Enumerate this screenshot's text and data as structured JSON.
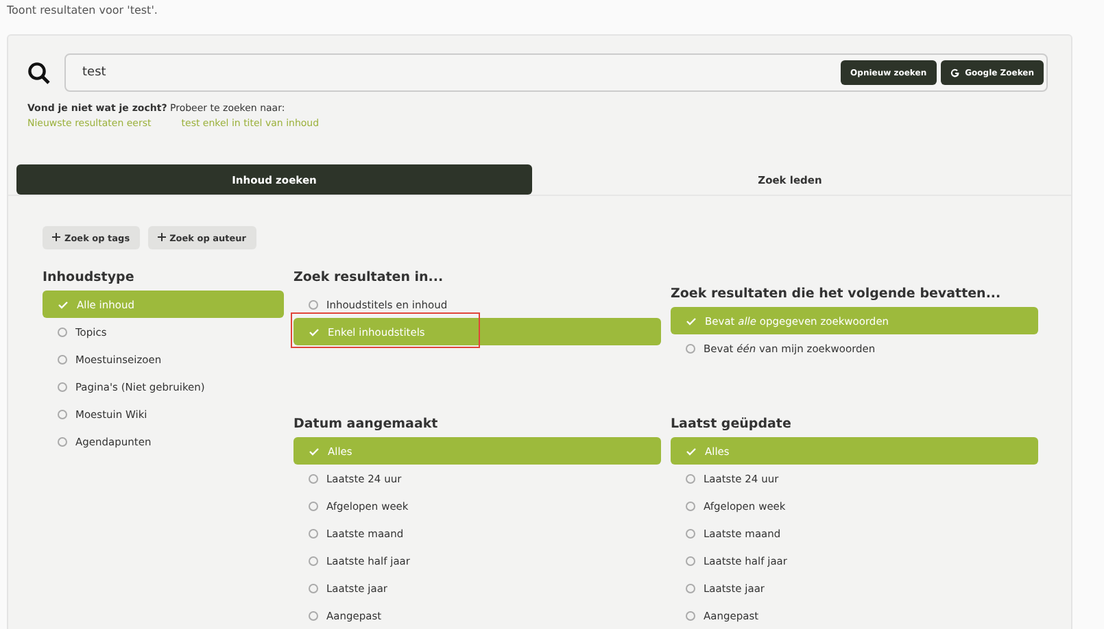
{
  "result_note": "Toont resultaten voor 'test'.",
  "search": {
    "value": "test",
    "buttons": [
      {
        "label": "Opnieuw zoeken",
        "kind": "plain"
      },
      {
        "label": "Google Zoeken",
        "kind": "google"
      }
    ]
  },
  "suggestions": {
    "prompt": "**Vond je niet wat je zocht?** Probeer te zoeken naar:",
    "links": [
      "Nieuwste resultaten eerst",
      "test enkel in titel van inhoud"
    ]
  },
  "tabs": [
    {
      "label": "Inhoud zoeken",
      "selected": true
    },
    {
      "label": "Zoek leden",
      "selected": false
    }
  ],
  "tag_buttons": [
    "Zoek op tags",
    "Zoek op auteur"
  ],
  "filter_groups": [
    {
      "title": "Inhoudstype",
      "options": [
        {
          "label": "Alle inhoud",
          "selected": true,
          "highlighted": false
        },
        {
          "label": "Topics",
          "selected": false,
          "highlighted": false
        },
        {
          "label": "Moestuinseizoen",
          "selected": false,
          "highlighted": false
        },
        {
          "label": "Pagina's (Niet gebruiken)",
          "selected": false,
          "highlighted": false
        },
        {
          "label": "Moestuin Wiki",
          "selected": false,
          "highlighted": false
        },
        {
          "label": "Agendapunten",
          "selected": false,
          "highlighted": false
        }
      ]
    },
    {
      "title": "Zoek resultaten in...",
      "options": [
        {
          "label": "Inhoudstitels en inhoud",
          "selected": false,
          "highlighted": false
        },
        {
          "label": "Enkel inhoudstitels",
          "selected": true,
          "highlighted": true
        }
      ]
    },
    {
      "title": "Zoek resultaten die het volgende bevatten...",
      "options": [
        {
          "label": "Bevat *alle* opgegeven zoekwoorden",
          "selected": true,
          "highlighted": false
        },
        {
          "label": "Bevat *één* van mijn zoekwoorden",
          "selected": false,
          "highlighted": false
        }
      ]
    },
    {
      "title": "Datum aangemaakt",
      "options": [
        {
          "label": "Alles",
          "selected": true,
          "highlighted": false
        },
        {
          "label": "Laatste 24 uur",
          "selected": false,
          "highlighted": false
        },
        {
          "label": "Afgelopen week",
          "selected": false,
          "highlighted": false
        },
        {
          "label": "Laatste maand",
          "selected": false,
          "highlighted": false
        },
        {
          "label": "Laatste half jaar",
          "selected": false,
          "highlighted": false
        },
        {
          "label": "Laatste jaar",
          "selected": false,
          "highlighted": false
        },
        {
          "label": "Aangepast",
          "selected": false,
          "highlighted": false
        }
      ]
    },
    {
      "title": "Laatst geüpdate",
      "options": [
        {
          "label": "Alles",
          "selected": true,
          "highlighted": false
        },
        {
          "label": "Laatste 24 uur",
          "selected": false,
          "highlighted": false
        },
        {
          "label": "Afgelopen week",
          "selected": false,
          "highlighted": false
        },
        {
          "label": "Laatste maand",
          "selected": false,
          "highlighted": false
        },
        {
          "label": "Laatste half jaar",
          "selected": false,
          "highlighted": false
        },
        {
          "label": "Laatste jaar",
          "selected": false,
          "highlighted": false
        },
        {
          "label": "Aangepast",
          "selected": false,
          "highlighted": false
        }
      ]
    }
  ]
}
